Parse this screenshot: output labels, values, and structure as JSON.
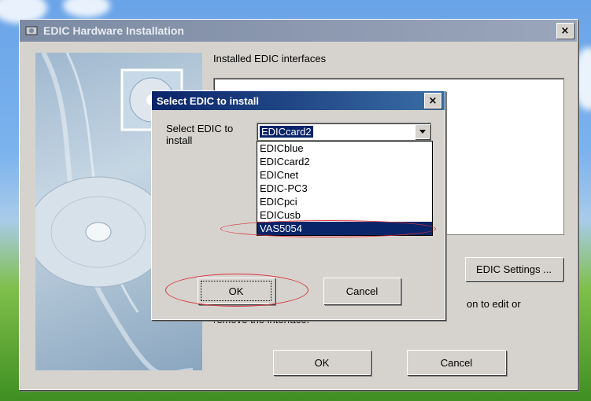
{
  "main_window": {
    "title": "EDIC Hardware Installation",
    "close_glyph": "×",
    "installed_label": "Installed EDIC interfaces",
    "settings_button": "EDIC Settings ...",
    "hint_text": "on to edit or remove the interface.",
    "ok_button": "OK",
    "cancel_button": "Cancel"
  },
  "dialog": {
    "title": "Select EDIC to install",
    "close_glyph": "×",
    "field_label": "Select EDIC to install",
    "selected_value": "EDICcard2",
    "options": [
      "EDICblue",
      "EDICcard2",
      "EDICnet",
      "EDIC-PC3",
      "EDICpci",
      "EDICusb",
      "VAS5054"
    ],
    "highlighted_option": "VAS5054",
    "ok_button": "OK",
    "cancel_button": "Cancel"
  },
  "colors": {
    "titlebar_active": "#0a246a",
    "titlebar_inactive": "#7c8aa3",
    "selection": "#0a246a",
    "annotation": "#d9343a"
  }
}
